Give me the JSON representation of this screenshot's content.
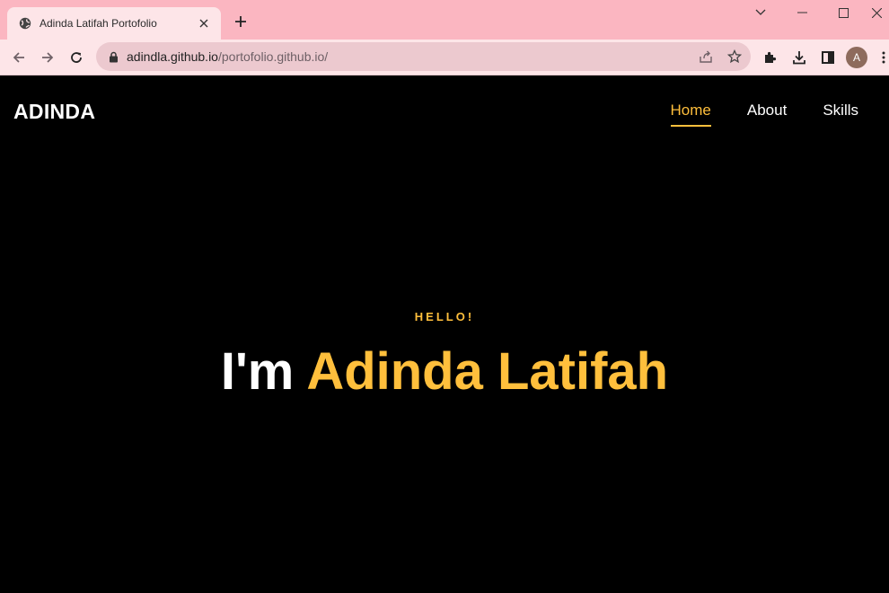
{
  "browser": {
    "tab_title": "Adinda Latifah Portofolio",
    "url_host": "adindla.github.io",
    "url_path": "/portofolio.github.io/",
    "profile_initial": "A"
  },
  "site": {
    "logo": "ADINDA",
    "nav": [
      "Home",
      "About",
      "Skills"
    ],
    "greeting": "HELLO!",
    "headline_prefix": "I'm ",
    "headline_name": "Adinda Latifah"
  },
  "colors": {
    "accent": "#ffbf3c",
    "background": "#000000",
    "chrome": "#fbb6c1"
  }
}
